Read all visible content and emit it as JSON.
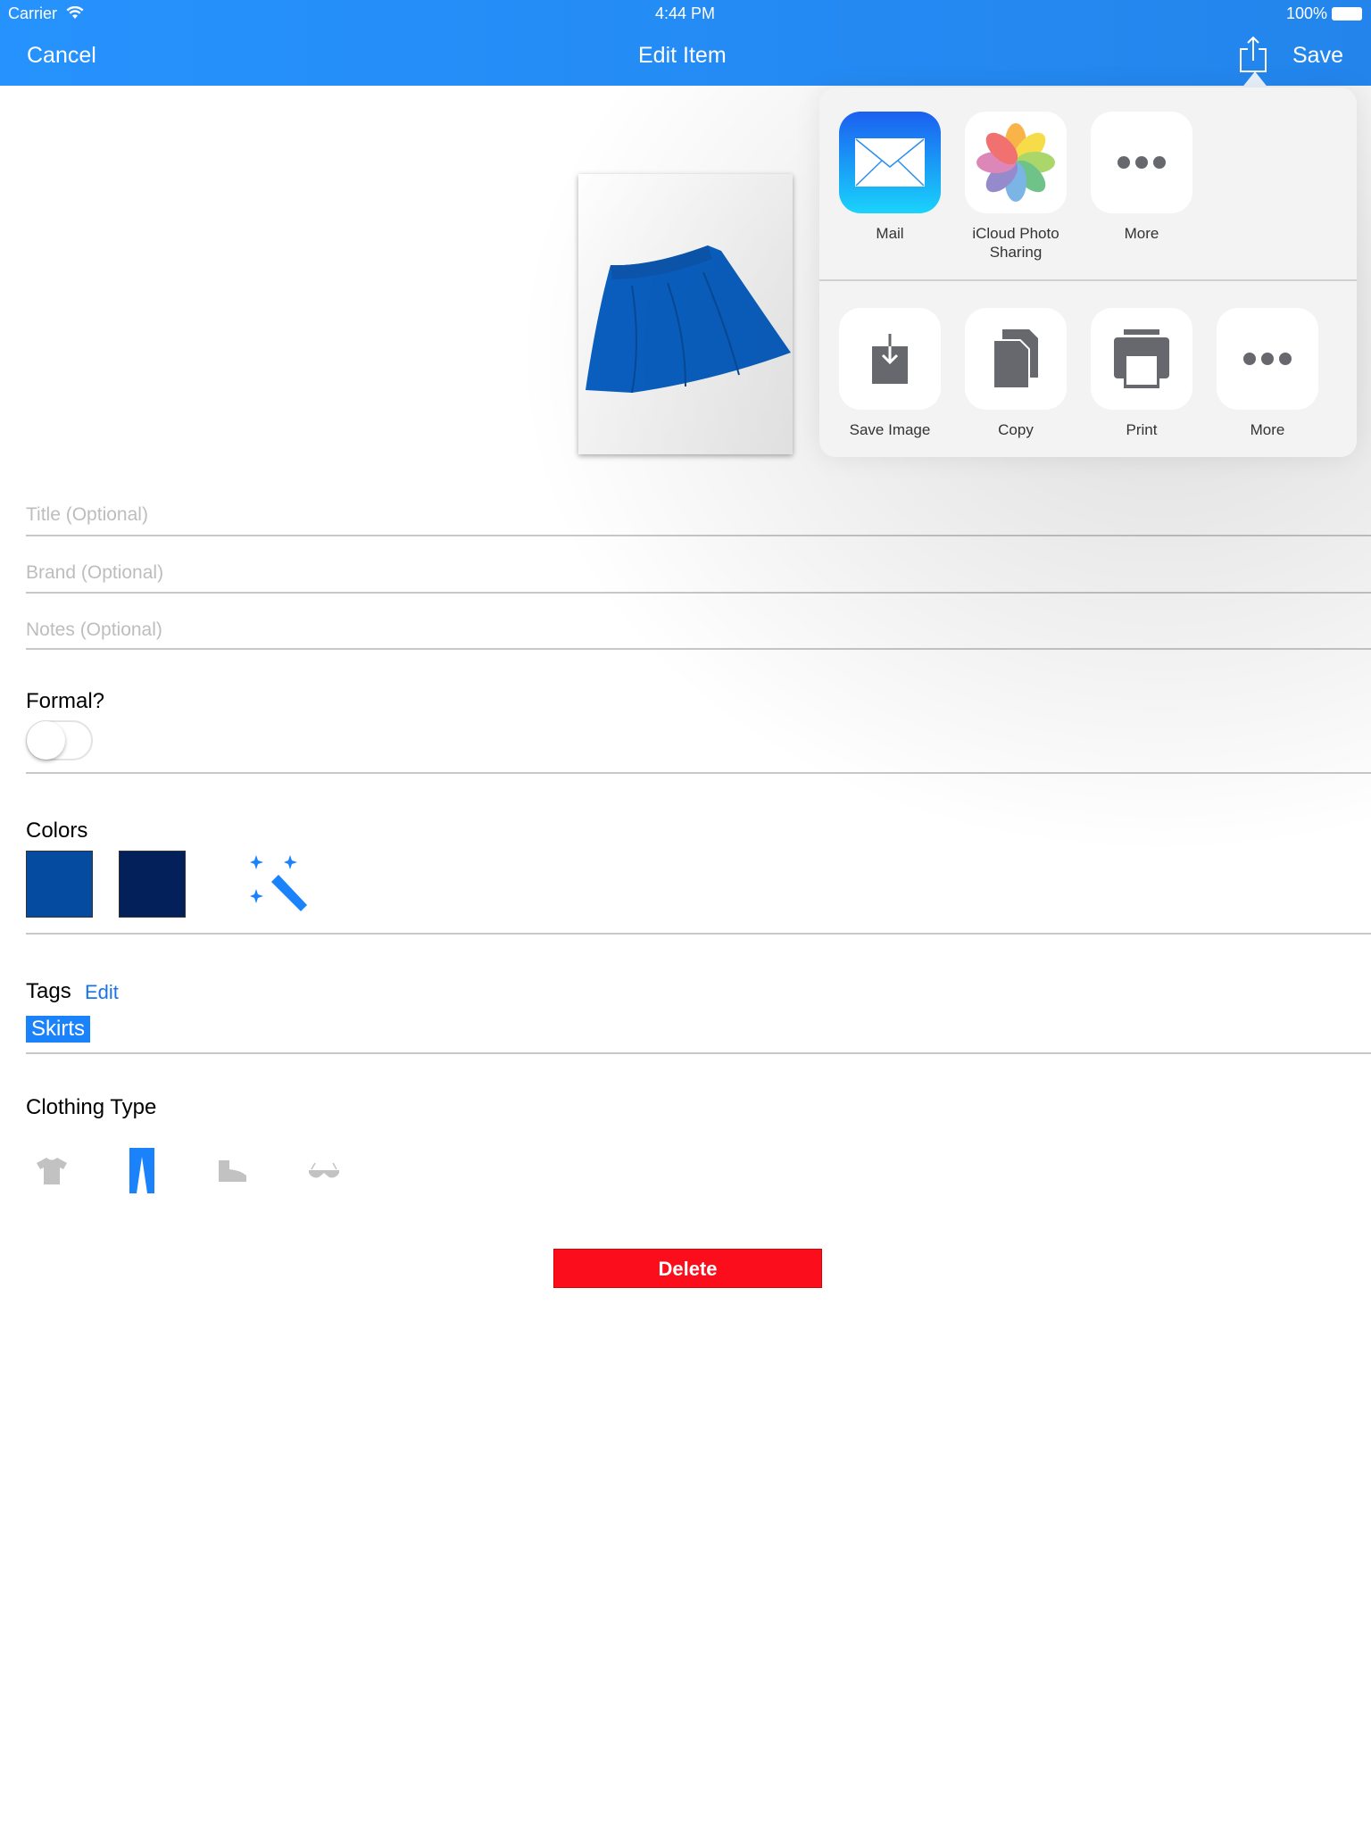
{
  "status_bar": {
    "carrier": "Carrier",
    "time": "4:44 PM",
    "battery": "100%"
  },
  "nav": {
    "cancel": "Cancel",
    "title": "Edit Item",
    "save": "Save"
  },
  "share_sheet": {
    "apps": [
      {
        "label": "Mail",
        "icon": "mail-icon"
      },
      {
        "label": "iCloud Photo Sharing",
        "icon": "photos-icon"
      },
      {
        "label": "More",
        "icon": "more-icon"
      }
    ],
    "actions": [
      {
        "label": "Save Image",
        "icon": "save-image-icon"
      },
      {
        "label": "Copy",
        "icon": "copy-icon"
      },
      {
        "label": "Print",
        "icon": "print-icon"
      },
      {
        "label": "More",
        "icon": "more-icon"
      }
    ]
  },
  "form": {
    "title_placeholder": "Title (Optional)",
    "brand_placeholder": "Brand (Optional)",
    "notes_placeholder": "Notes (Optional)",
    "formal_label": "Formal?",
    "formal_on": false,
    "colors_label": "Colors",
    "colors": [
      "#054ca0",
      "#03205a"
    ],
    "tags_label": "Tags",
    "tags_edit": "Edit",
    "tags": [
      "Skirts"
    ],
    "clothing_type_label": "Clothing Type",
    "clothing_types": [
      "top",
      "bottom",
      "shoes",
      "accessories"
    ],
    "selected_clothing_type": "bottom",
    "delete": "Delete"
  }
}
